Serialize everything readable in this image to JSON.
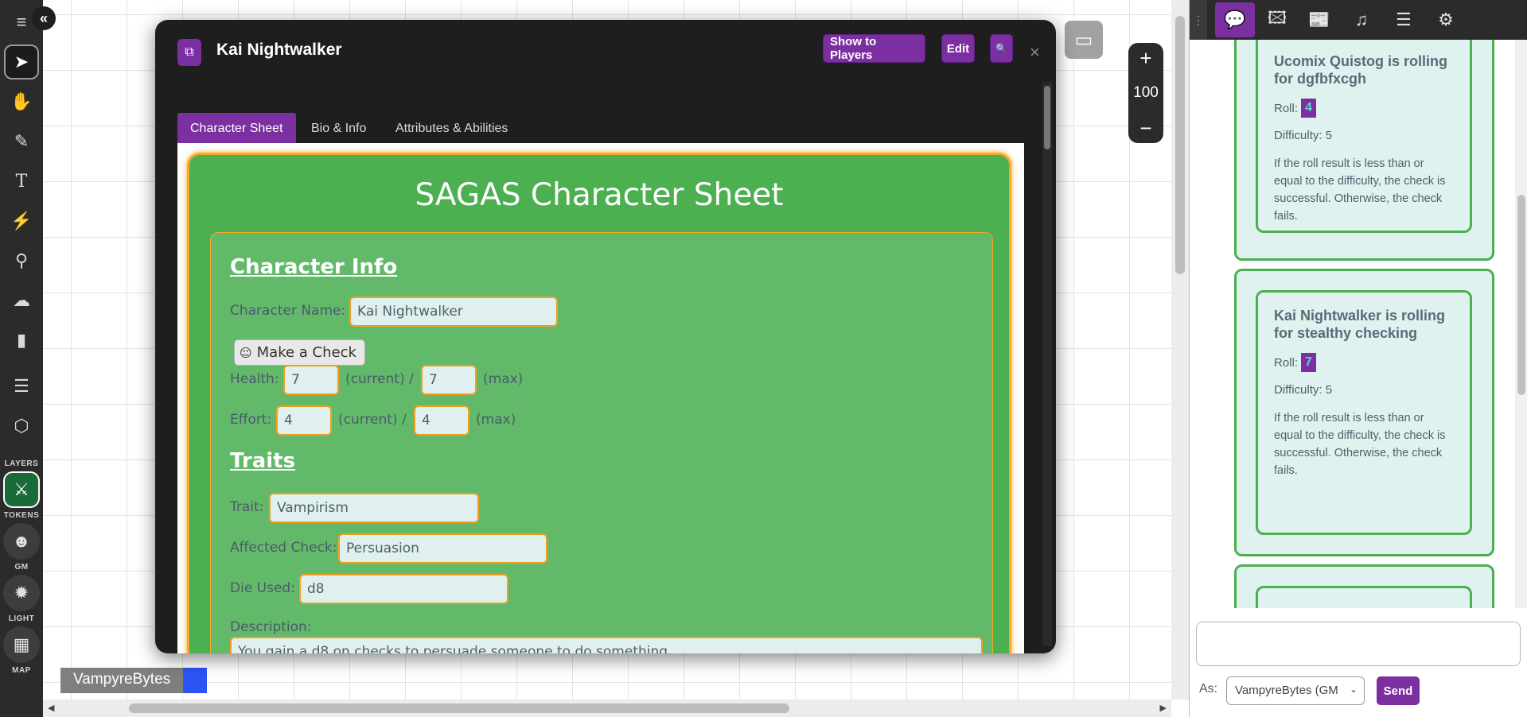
{
  "toolbar": {
    "layers_label": "LAYERS",
    "tokens_label": "TOKENS",
    "gm_label": "GM",
    "light_label": "LIGHT",
    "map_label": "MAP",
    "icons": [
      "menu-icon",
      "select-icon",
      "pan-icon",
      "draw-icon",
      "text-icon",
      "fx-icon",
      "measure-icon",
      "fog-icon",
      "ruler-icon",
      "notes-icon",
      "dice-icon"
    ]
  },
  "zoom": {
    "level": "100",
    "in": "+",
    "out": "−"
  },
  "player": {
    "name": "VampyreBytes",
    "color": "#2b55f5"
  },
  "dialog": {
    "title": "Kai Nightwalker",
    "buttons": {
      "show_players": "Show to Players",
      "edit": "Edit",
      "search": "🔍",
      "close": "×"
    },
    "tabs": [
      "Character Sheet",
      "Bio & Info",
      "Attributes & Abilities"
    ],
    "sheet": {
      "title": "SAGAS Character Sheet",
      "info_heading": "Character Info",
      "name_label": "Character Name:",
      "name_value": "Kai Nightwalker",
      "check_button": "Make a Check",
      "health_label": "Health:",
      "health_current": "7",
      "health_max": "7",
      "effort_label": "Effort:",
      "effort_current": "4",
      "effort_max": "4",
      "current_label": "(current) /",
      "max_label": "(max)",
      "traits_heading": "Traits",
      "trait_label": "Trait:",
      "trait_value": "Vampirism",
      "affected_label": "Affected Check:",
      "affected_value": "Persuasion",
      "die_label": "Die Used:",
      "die_value": "d8",
      "description_label": "Description:",
      "description_value": "You gain a d8 on checks to persuade someone to do something"
    }
  },
  "chat": {
    "messages": [
      {
        "title": "Ucomix Quistog is rolling for dgfbfxcgh",
        "roll_label": "Roll:",
        "roll": "4",
        "difficulty": "Difficulty: 5",
        "description": "If the roll result is less than or equal to the difficulty, the check is successful. Otherwise, the check fails."
      },
      {
        "title": "Kai Nightwalker is rolling for stealthy checking",
        "roll_label": "Roll:",
        "roll": "7",
        "difficulty": "Difficulty: 5",
        "description": "If the roll result is less than or equal to the difficulty, the check is successful. Otherwise, the check fails."
      }
    ],
    "as_label": "As:",
    "as_value": "VampyreBytes (GM",
    "send_label": "Send"
  },
  "colors": {
    "accent": "#7b2fa0",
    "sheet_green": "#4caf50",
    "border_orange": "#f9a825"
  }
}
